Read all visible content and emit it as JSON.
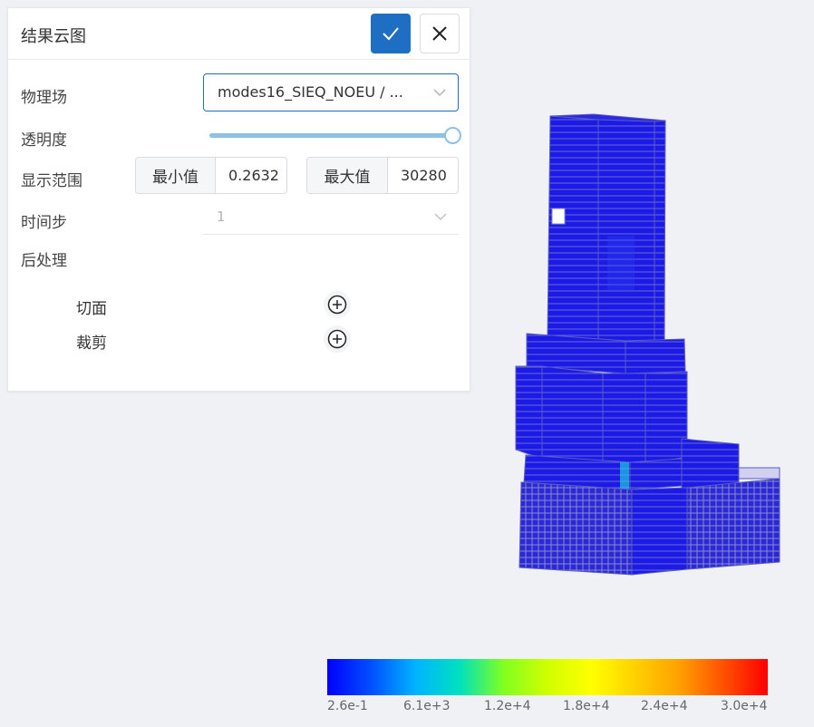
{
  "panel": {
    "title": "结果云图",
    "fields": {
      "physics_label": "物理场",
      "physics_value": "modes16_SIEQ_NOEU / ...",
      "opacity_label": "透明度",
      "opacity_value": 1.0,
      "range_label": "显示范围",
      "min_label": "最小值",
      "min_value": "0.2632",
      "max_label": "最大值",
      "max_value": "30280",
      "timestep_label": "时间步",
      "timestep_value": "1",
      "postprocess_label": "后处理"
    },
    "postprocess_items": [
      {
        "label": "切面"
      },
      {
        "label": "裁剪"
      }
    ]
  },
  "colorbar": {
    "ticks": [
      "2.6e-1",
      "6.1e+3",
      "1.2e+4",
      "1.8e+4",
      "2.4e+4",
      "3.0e+4"
    ]
  },
  "colors": {
    "accent": "#1e6fc4",
    "model_blue": "#1a1aee"
  }
}
